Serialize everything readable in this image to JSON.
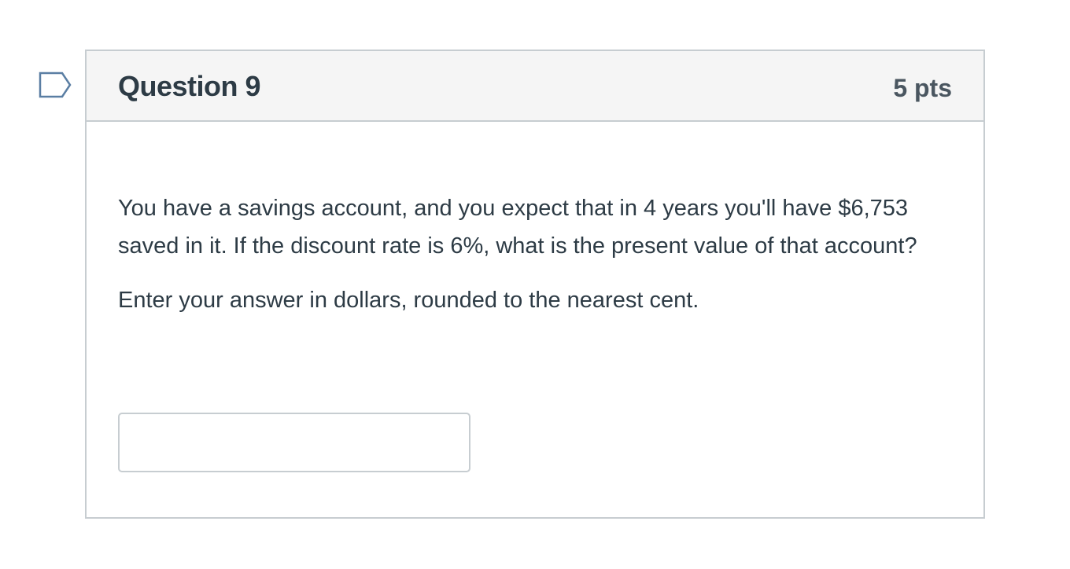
{
  "question": {
    "title": "Question 9",
    "points": "5 pts",
    "prompt": "You have a savings account, and you expect that in 4 years you'll have $6,753 saved in it. If the discount rate is 6%, what is the present value of that account?",
    "instruction": "Enter your answer in dollars, rounded to the nearest cent.",
    "answer_value": "",
    "answer_placeholder": "",
    "flag_icon": "flag-question-icon"
  },
  "colors": {
    "text": "#2d3b45",
    "border": "#c7cdd1",
    "header_bg": "#f5f5f5",
    "flag": "#5a7ea3"
  }
}
